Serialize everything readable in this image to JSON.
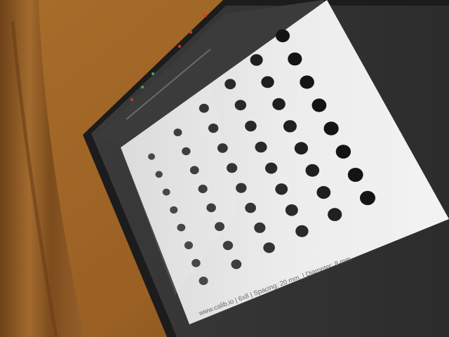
{
  "photo": {
    "subject": "Monitor displaying a circle-grid calibration target",
    "caption": "www.calib.io | 6x8 | Spacing: 20 mm. | Diameter: 8 mm.",
    "grid": {
      "columns": 6,
      "rows": 8
    },
    "colors": {
      "wall": "#a86d2a",
      "curtain": "#8a5626",
      "bezel": "#1c1c1c",
      "screen_dark": "#2f2f2f",
      "target_paper": "#efefef",
      "dot": "#141414"
    }
  }
}
